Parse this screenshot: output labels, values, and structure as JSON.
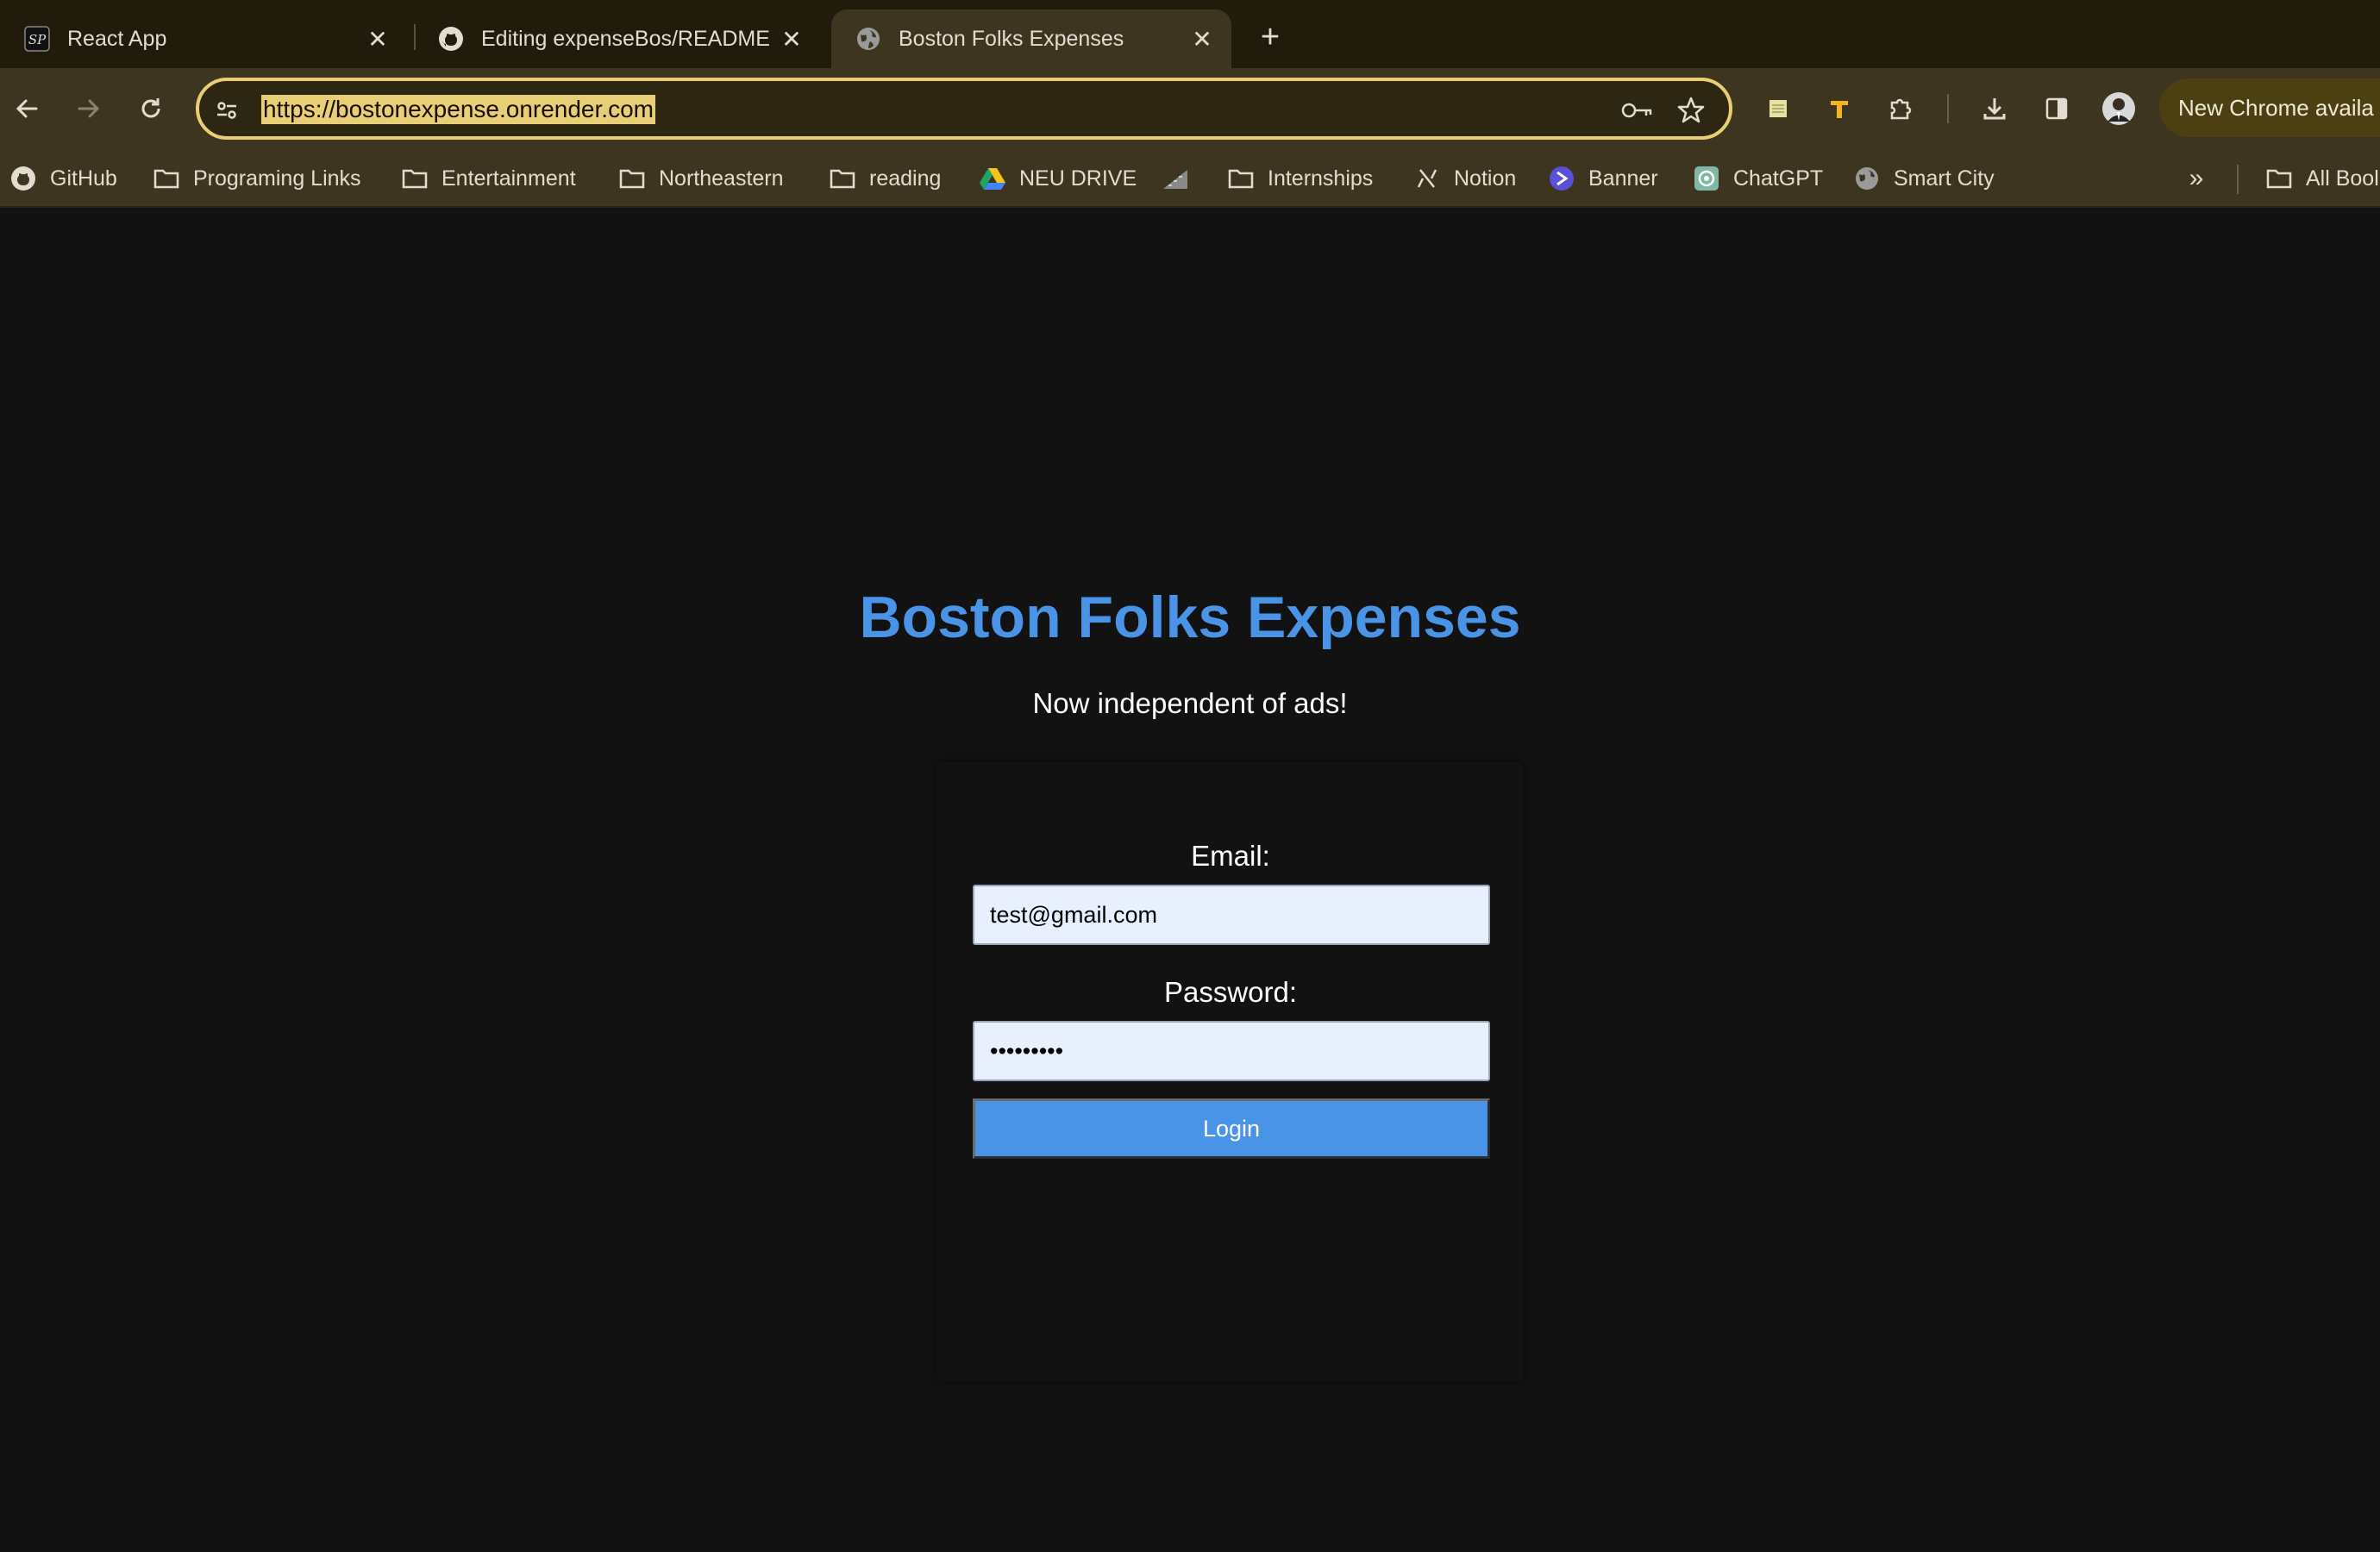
{
  "browser": {
    "tabs": [
      {
        "title": "React App",
        "icon": "sp-logo-icon",
        "active": false
      },
      {
        "title": "Editing expenseBos/README",
        "icon": "github-icon",
        "active": false
      },
      {
        "title": "Boston Folks Expenses",
        "icon": "globe-icon",
        "active": true
      }
    ],
    "address": {
      "url": "https://bostonexpense.onrender.com"
    },
    "update_banner": "New Chrome availa",
    "bookmarks": [
      {
        "label": "GitHub",
        "icon": "github-icon"
      },
      {
        "label": "Programing Links",
        "icon": "folder-icon"
      },
      {
        "label": "Entertainment",
        "icon": "folder-icon"
      },
      {
        "label": "Northeastern",
        "icon": "folder-icon"
      },
      {
        "label": "reading",
        "icon": "folder-icon"
      },
      {
        "label": "NEU DRIVE",
        "icon": "google-drive-icon"
      },
      {
        "label": "Internships",
        "icon": "folder-icon"
      },
      {
        "label": "Notion",
        "icon": "notion-icon"
      },
      {
        "label": "Banner",
        "icon": "banner-icon"
      },
      {
        "label": "ChatGPT",
        "icon": "chatgpt-icon"
      },
      {
        "label": "Smart City",
        "icon": "globe-icon"
      },
      {
        "label": "All Bool",
        "icon": "folder-icon"
      }
    ]
  },
  "app": {
    "title": "Boston Folks Expenses",
    "tagline": "Now independent of ads!",
    "email_label": "Email:",
    "email_value": "test@gmail.com",
    "password_label": "Password:",
    "password_value": "•••••••••",
    "login_label": "Login",
    "accent_color": "#4a94e8"
  }
}
